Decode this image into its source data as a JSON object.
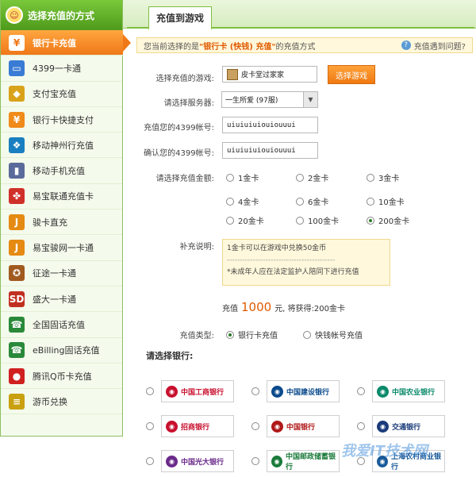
{
  "sidebar": {
    "title": "选择充值的方式",
    "items": [
      {
        "label": "银行卡充值",
        "icon": "yen-icon",
        "glyph": "¥",
        "active": true
      },
      {
        "label": "4399一卡通",
        "icon": "card-icon",
        "glyph": "▭"
      },
      {
        "label": "支付宝充值",
        "icon": "shield-icon",
        "glyph": "◆"
      },
      {
        "label": "银行卡快捷支付",
        "icon": "yen-icon",
        "glyph": "¥"
      },
      {
        "label": "移动神州行充值",
        "icon": "shenzhouxing-icon",
        "glyph": "❖"
      },
      {
        "label": "移动手机充值",
        "icon": "mobile-phone-icon",
        "glyph": "▮"
      },
      {
        "label": "易宝联通充值卡",
        "icon": "unicom-icon",
        "glyph": "✤"
      },
      {
        "label": "骏卡直充",
        "icon": "junka-icon",
        "glyph": "J"
      },
      {
        "label": "易宝骏网一卡通",
        "icon": "junka-icon",
        "glyph": "J"
      },
      {
        "label": "征途一卡通",
        "icon": "zhengtu-icon",
        "glyph": "✪"
      },
      {
        "label": "盛大一卡通",
        "icon": "shanda-icon",
        "glyph": "SD"
      },
      {
        "label": "全国固话充值",
        "icon": "telephone-icon",
        "glyph": "☎"
      },
      {
        "label": "eBilling固话充值",
        "icon": "telephone-icon",
        "glyph": "☎"
      },
      {
        "label": "腾讯Q币卡充值",
        "icon": "qq-penguin-icon",
        "glyph": "●"
      },
      {
        "label": "游币兑换",
        "icon": "coins-icon",
        "glyph": "≡"
      }
    ]
  },
  "tab": {
    "label": "充值到游戏"
  },
  "notice": {
    "prefix": "您当前选择的是",
    "highlight": "\"银行卡 (快钱) 充值\"",
    "suffix": "的充值方式",
    "help": "充值遇到问题?"
  },
  "form": {
    "game_label": "选择充值的游戏:",
    "game_value": "皮卡堂过家家",
    "choose_game_button": "选择游戏",
    "server_label": "请选择服务器:",
    "server_value": "一生所爱 (97服)",
    "account_label": "充值您的4399帐号:",
    "account_value": "uiuiuiuiouiouuui",
    "confirm_label": "确认您的4399帐号:",
    "confirm_value": "uiuiuiuiouiouuui",
    "amount_label": "请选择充值金额:",
    "amounts": [
      {
        "label": "1金卡",
        "checked": false
      },
      {
        "label": "2金卡",
        "checked": false
      },
      {
        "label": "3金卡",
        "checked": false
      },
      {
        "label": "4金卡",
        "checked": false
      },
      {
        "label": "6金卡",
        "checked": false
      },
      {
        "label": "10金卡",
        "checked": false
      },
      {
        "label": "20金卡",
        "checked": false
      },
      {
        "label": "100金卡",
        "checked": false
      },
      {
        "label": "200金卡",
        "checked": true
      }
    ],
    "note_label": "补充说明:",
    "note_lines": [
      "1金卡可以在游戏中兑换50金币",
      "------------------------------------------",
      "*未成年人应在法定监护人陪同下进行充值"
    ],
    "summary_prefix": "充值",
    "summary_amount": "1000",
    "summary_suffix": "元, 将获得:200金卡",
    "type_label": "充值类型:",
    "types": [
      {
        "label": "银行卡充值",
        "checked": true
      },
      {
        "label": "快钱帐号充值",
        "checked": false
      }
    ]
  },
  "banks": {
    "title": "请选择银行:",
    "items": [
      {
        "name": "中国工商银行",
        "icon": "icbc-logo-icon",
        "color": "#c8102e"
      },
      {
        "name": "中国建设银行",
        "icon": "ccb-logo-icon",
        "color": "#0a4a8c"
      },
      {
        "name": "中国农业银行",
        "icon": "abc-logo-icon",
        "color": "#0a8a6a"
      },
      {
        "name": "招商银行",
        "icon": "cmb-logo-icon",
        "color": "#c8102e"
      },
      {
        "name": "中国银行",
        "icon": "boc-logo-icon",
        "color": "#b01818"
      },
      {
        "name": "交通银行",
        "icon": "bocom-logo-icon",
        "color": "#1a3a7a"
      },
      {
        "name": "中国光大银行",
        "icon": "ceb-logo-icon",
        "color": "#6a2a8a"
      },
      {
        "name": "中国邮政储蓄银行",
        "icon": "psbc-logo-icon",
        "color": "#1a7a3a"
      },
      {
        "name": "上海农村商业银行",
        "icon": "srcb-logo-icon",
        "color": "#1a5a9a"
      }
    ]
  },
  "watermark": "我爱IT技术网"
}
